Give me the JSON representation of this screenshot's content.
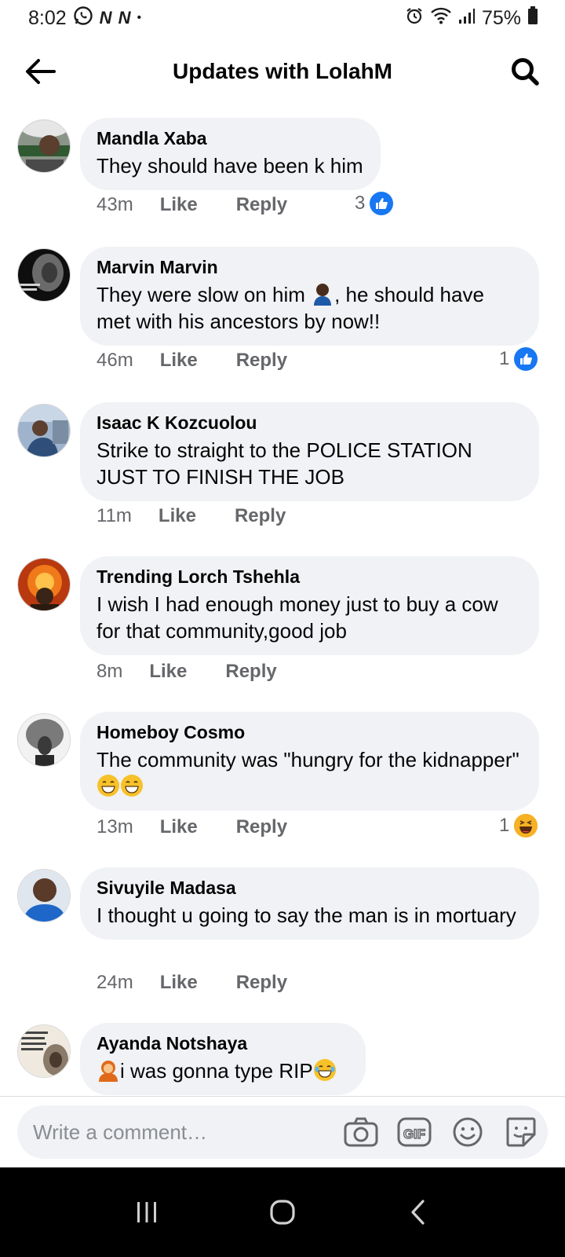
{
  "status_bar": {
    "time": "8:02",
    "glyph1": "N",
    "glyph2": "N",
    "dot": "•",
    "battery": "75%",
    "icons": [
      "whatsapp-icon",
      "alarm-icon",
      "wifi-icon",
      "signal-icon",
      "battery-icon"
    ]
  },
  "header": {
    "title": "Updates with LolahM"
  },
  "comments": [
    {
      "author": "Mandla Xaba",
      "text": "They should have been k him",
      "time": "43m",
      "like": "Like",
      "reply": "Reply",
      "reaction_count": "3",
      "reaction": "like"
    },
    {
      "author": "Marvin Marvin",
      "text_before": "They were slow on him ",
      "text_after": ", he should have met with his ancestors by now!!",
      "time": "46m",
      "like": "Like",
      "reply": "Reply",
      "reaction_count": "1",
      "reaction": "like"
    },
    {
      "author": "Isaac K Kozcuolou",
      "text": "Strike to straight to the POLICE STATION JUST TO FINISH THE JOB",
      "time": "11m",
      "like": "Like",
      "reply": "Reply"
    },
    {
      "author": "Trending Lorch Tshehla",
      "text": "I wish I had enough money just to buy a cow for that community,good job",
      "time": "8m",
      "like": "Like",
      "reply": "Reply"
    },
    {
      "author": "Homeboy Cosmo",
      "text": "The community was \"hungry for the kidnapper\" ",
      "time": "13m",
      "like": "Like",
      "reply": "Reply",
      "reaction_count": "1",
      "reaction": "haha"
    },
    {
      "author": "Sivuyile Madasa",
      "text": "I thought u going to say the man is in mortuary",
      "time": "24m",
      "like": "Like",
      "reply": "Reply"
    },
    {
      "author": "Ayanda Notshaya",
      "text": "i was gonna type RIP"
    }
  ],
  "composer": {
    "placeholder": "Write a comment…"
  },
  "colors": {
    "bubble": "#f0f2f5",
    "meta_text": "#65676b",
    "like_blue": "#1877f2",
    "haha_yellow": "#f7b125"
  }
}
